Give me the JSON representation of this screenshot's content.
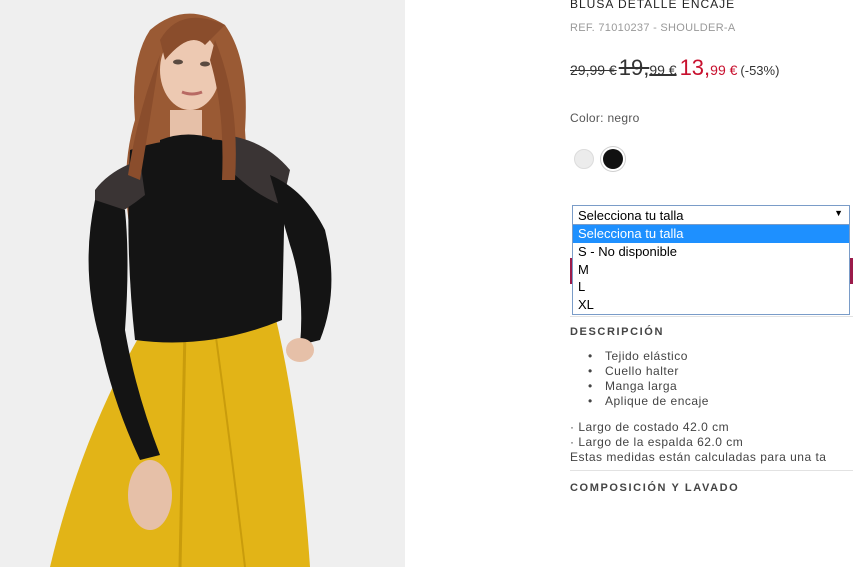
{
  "product": {
    "title": "BLUSA DETALLE ENCAJE",
    "ref": "REF. 71010237 - SHOULDER-A",
    "price_original_small": "29,99 €",
    "price_original_int": "19,",
    "price_original_dec": "99 €",
    "price_sale_int": "13,",
    "price_sale_dec": "99 €",
    "discount": "(-53%)",
    "color_label": "Color: negro",
    "colors": [
      "#ececec",
      "#111111"
    ],
    "sale_color": "#c8102e"
  },
  "size_select": {
    "selected": "Selecciona tu talla",
    "options": [
      "Selecciona tu talla",
      "S - No disponible",
      "M",
      "L",
      "XL"
    ]
  },
  "description": {
    "heading": "DESCRIPCIÓN",
    "bullets": [
      "Tejido elástico",
      "Cuello halter",
      "Manga larga",
      "Aplique de encaje"
    ],
    "measure_1": "· Largo de costado 42.0 cm",
    "measure_2": "· Largo de la espalda 62.0 cm",
    "measure_note": "Estas medidas están calculadas para una ta"
  },
  "composition": {
    "heading": "COMPOSICIÓN Y LAVADO"
  }
}
